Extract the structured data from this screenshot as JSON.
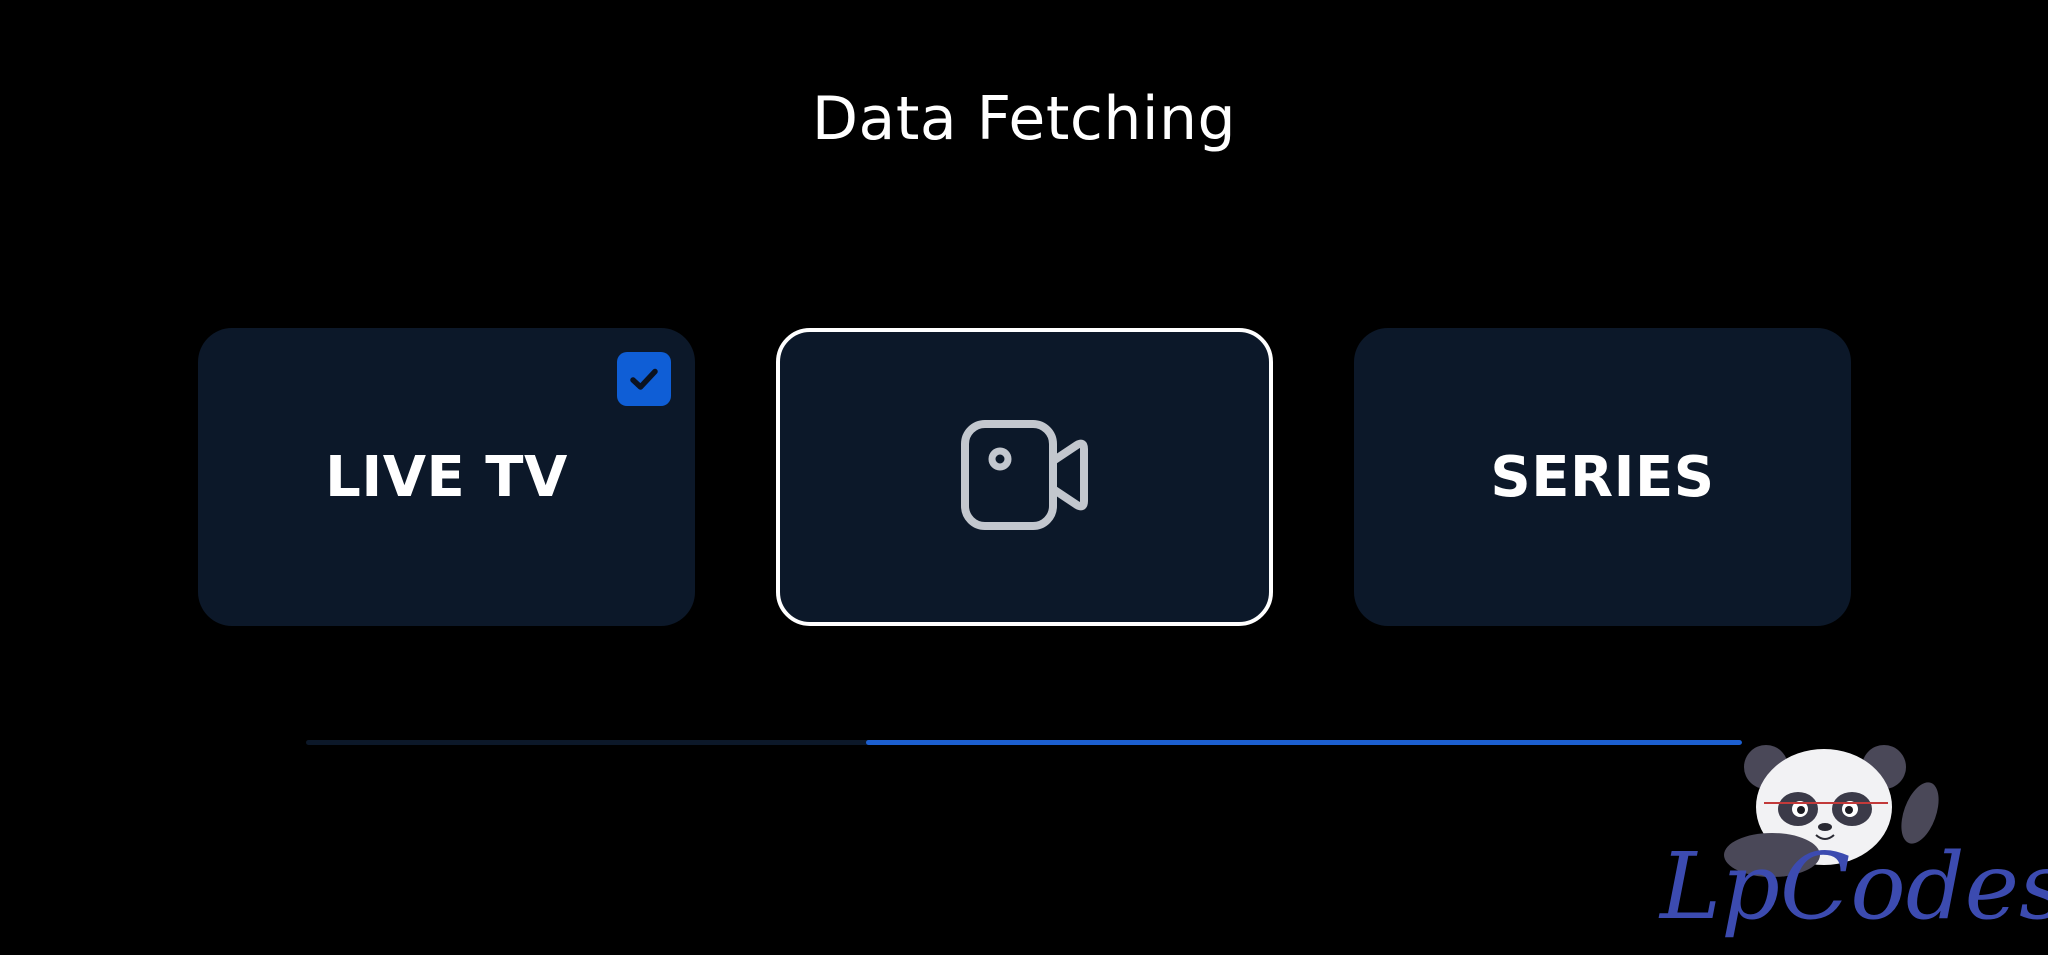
{
  "header": {
    "title": "Data Fetching"
  },
  "cards": [
    {
      "label": "LIVE TV",
      "completed": true
    },
    {
      "label": "",
      "icon": "video-camera-icon",
      "active": true
    },
    {
      "label": "SERIES",
      "completed": false
    }
  ],
  "progress": {
    "fraction": 0.61
  },
  "watermark": {
    "text": "LpCodes"
  },
  "colors": {
    "background": "#000000",
    "card": "#0c1829",
    "accent": "#1c5fd0",
    "check_badge": "#0f5ed6",
    "active_border": "#ffffff"
  }
}
